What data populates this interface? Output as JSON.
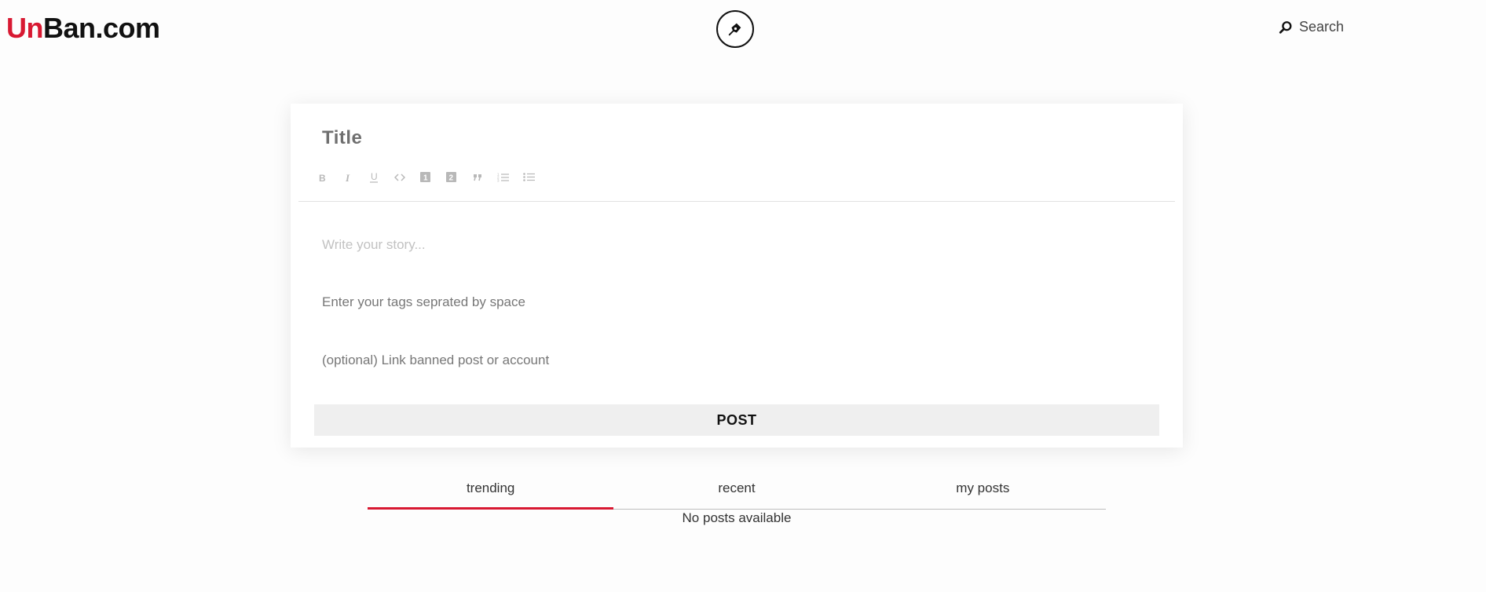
{
  "header": {
    "logo_accent": "Un",
    "logo_rest": "Ban.com",
    "compose_icon": "pen-nib-icon",
    "search_icon": "search-icon",
    "search_label": "Search"
  },
  "editor": {
    "title_placeholder": "Title",
    "toolbar": [
      {
        "name": "bold-icon",
        "glyph": "B"
      },
      {
        "name": "italic-icon",
        "glyph": "I"
      },
      {
        "name": "underline-icon",
        "glyph": "U"
      },
      {
        "name": "code-icon",
        "glyph": "<>"
      },
      {
        "name": "heading-1-icon",
        "glyph": "1"
      },
      {
        "name": "heading-2-icon",
        "glyph": "2"
      },
      {
        "name": "blockquote-icon",
        "glyph": "”"
      },
      {
        "name": "ordered-list-icon",
        "glyph": "ol"
      },
      {
        "name": "unordered-list-icon",
        "glyph": "ul"
      }
    ],
    "story_placeholder": "Write your story...",
    "tags_placeholder": "Enter your tags seprated by space",
    "link_placeholder": "(optional) Link banned post or account",
    "post_label": "POST"
  },
  "tabs": [
    {
      "label": "trending",
      "active": true
    },
    {
      "label": "recent",
      "active": false
    },
    {
      "label": "my posts",
      "active": false
    }
  ],
  "feed": {
    "empty_message": "No posts available"
  },
  "colors": {
    "brand": "#d81932",
    "text": "#111111",
    "button_bg": "#efefef"
  }
}
